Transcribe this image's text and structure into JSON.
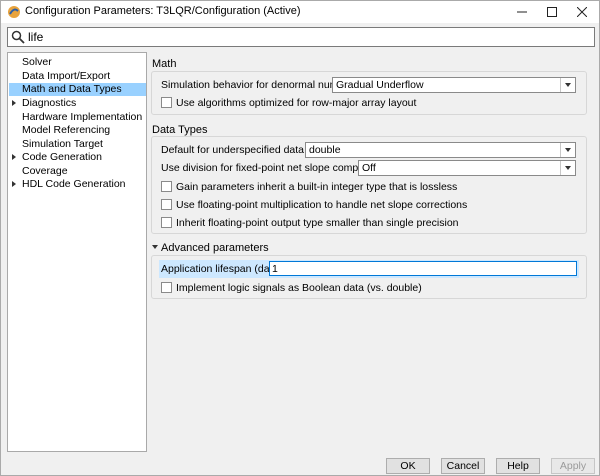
{
  "window": {
    "title": "Configuration Parameters: T3LQR/Configuration (Active)",
    "controls": [
      "—",
      "☐",
      "✕"
    ]
  },
  "search": {
    "value": "life",
    "placeholder": ""
  },
  "tree": {
    "items": [
      {
        "label": "Solver",
        "expandable": false,
        "selected": false
      },
      {
        "label": "Data Import/Export",
        "expandable": false,
        "selected": false
      },
      {
        "label": "Math and Data Types",
        "expandable": false,
        "selected": true
      },
      {
        "label": "Diagnostics",
        "expandable": true,
        "selected": false
      },
      {
        "label": "Hardware Implementation",
        "expandable": false,
        "selected": false
      },
      {
        "label": "Model Referencing",
        "expandable": false,
        "selected": false
      },
      {
        "label": "Simulation Target",
        "expandable": false,
        "selected": false
      },
      {
        "label": "Code Generation",
        "expandable": true,
        "selected": false
      },
      {
        "label": "Coverage",
        "expandable": false,
        "selected": false
      },
      {
        "label": "HDL Code Generation",
        "expandable": true,
        "selected": false
      }
    ]
  },
  "math": {
    "title": "Math",
    "denormal_label": "Simulation behavior for denormal numbers:",
    "denormal_value": "Gradual Underflow",
    "row_major_label": "Use algorithms optimized for row-major array layout"
  },
  "data_types": {
    "title": "Data Types",
    "underspecified_label": "Default for underspecified data type:",
    "underspecified_value": "double",
    "division_label": "Use division for fixed-point net slope computation:",
    "division_value": "Off",
    "gain_label": "Gain parameters inherit a built-in integer type that is lossless",
    "float_mult_label": "Use floating-point multiplication to handle net slope corrections",
    "inherit_label": "Inherit floating-point output type smaller than single precision"
  },
  "advanced": {
    "title": "Advanced parameters",
    "lifespan_label": "Application lifespan (days):",
    "lifespan_value": "1",
    "logic_label": "Implement logic signals as Boolean data (vs. double)"
  },
  "buttons": {
    "ok": "OK",
    "cancel": "Cancel",
    "help": "Help",
    "apply": "Apply"
  }
}
